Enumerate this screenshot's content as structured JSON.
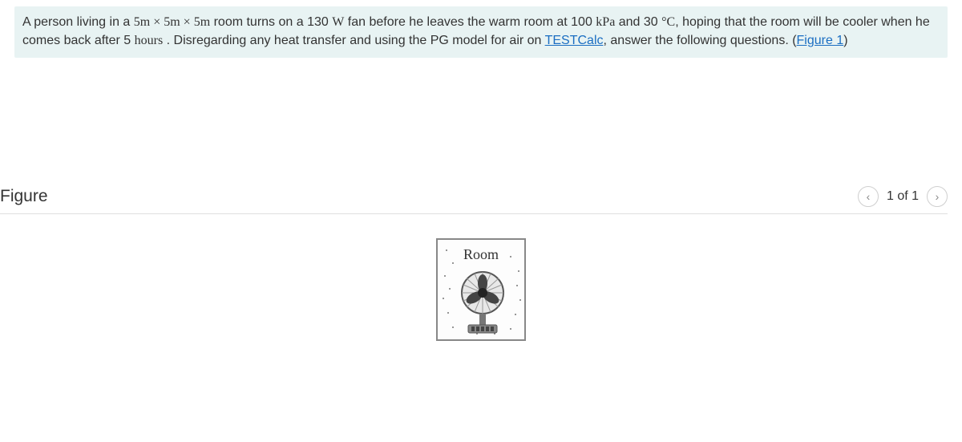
{
  "problem": {
    "text_parts": {
      "p1": "A person living in a ",
      "dim": "5m × 5m × 5m",
      "p2": " room turns on a 130 ",
      "watt": "W",
      "p3": " fan before he leaves the warm room at 100 ",
      "kpa": "kPa",
      "p4": " and 30 ",
      "degc": "°C",
      "p5": ", hoping that the room will be cooler when he comes back after 5 ",
      "hours": "hours",
      "p6": " . Disregarding any heat transfer and using the PG model for air on ",
      "link1": "TESTCalc",
      "p7": ", answer the following questions. (",
      "link2": "Figure 1",
      "p8": ")"
    }
  },
  "figure": {
    "title": "Figure",
    "pager": {
      "prev_glyph": "‹",
      "label": "1 of 1",
      "next_glyph": "›"
    },
    "room_label": "Room"
  }
}
